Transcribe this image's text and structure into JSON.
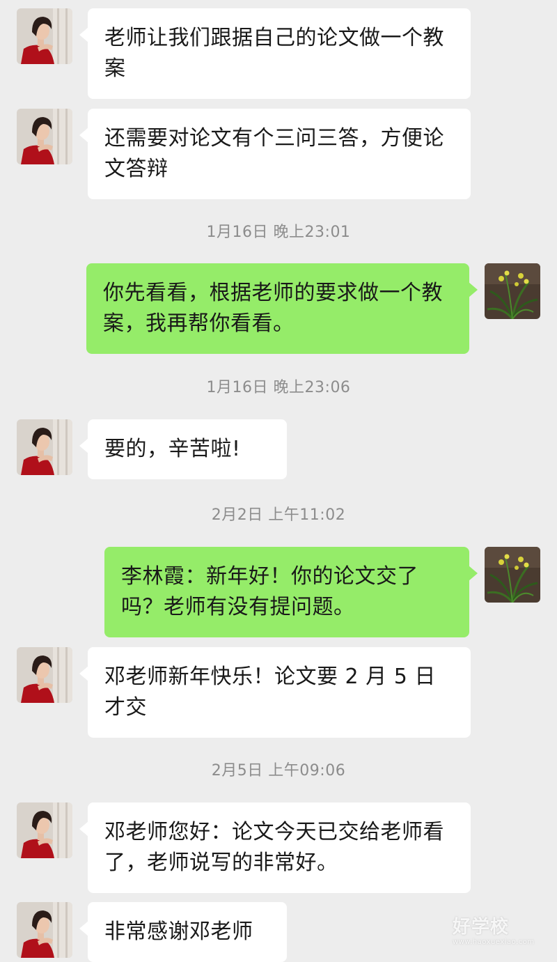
{
  "timestamps": [
    "1月16日 晚上23:01",
    "1月16日 晚上23:06",
    "2月2日 上午11:02",
    "2月5日 上午09:06"
  ],
  "messages": [
    {
      "text": "老师让我们跟据自己的论文做一个教案"
    },
    {
      "text": "还需要对论文有个三问三答，方便论文答辩"
    },
    {
      "text": "你先看看，根据老师的要求做一个教案，我再帮你看看。"
    },
    {
      "text": "要的，辛苦啦!"
    },
    {
      "text": "李林霞：新年好！你的论文交了吗？老师有没有提问题。"
    },
    {
      "text": "邓老师新年快乐！论文要 2 月 5 日才交"
    },
    {
      "text": "邓老师您好：论文今天已交给老师看了，老师说写的非常好。"
    },
    {
      "text": "非常感谢邓老师"
    }
  ],
  "avatars": {
    "left": "woman-portrait-avatar",
    "right": "orchid-plant-avatar"
  },
  "watermark": {
    "logo": "好学校",
    "url": "www.haoxuexiao.com"
  },
  "colors": {
    "background": "#ededed",
    "incoming_bubble": "#ffffff",
    "outgoing_bubble": "#95ec69",
    "timestamp_text": "#8c8c8c"
  }
}
